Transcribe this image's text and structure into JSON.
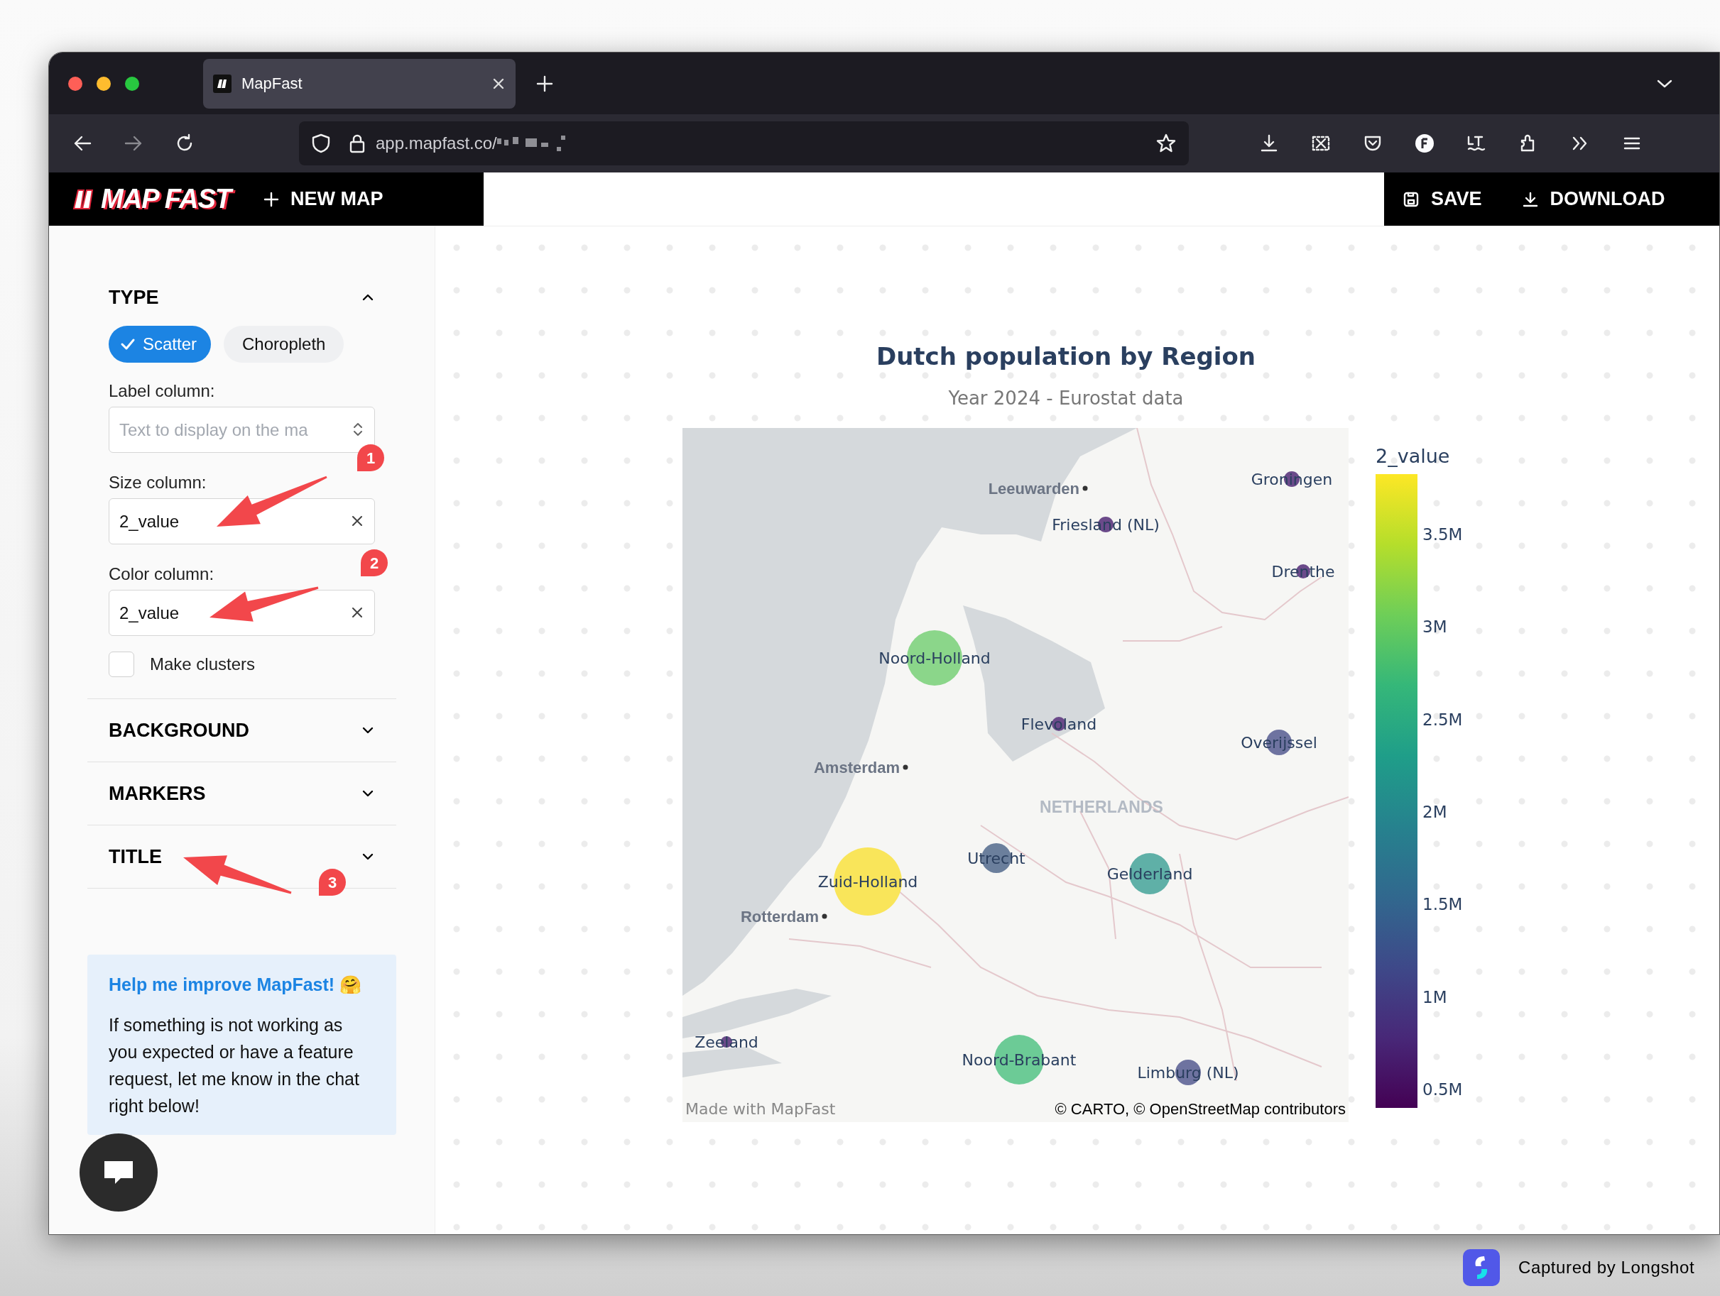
{
  "browser": {
    "tab_title": "MapFast",
    "url": "app.mapfast.co/"
  },
  "app_header": {
    "logo": "MAP FAST",
    "new_map": "NEW MAP",
    "actions": [
      {
        "kind": "save",
        "label": "SAVE"
      },
      {
        "kind": "download",
        "label": "DOWNLOAD"
      }
    ]
  },
  "sidebar": {
    "sections": [
      {
        "title": "TYPE",
        "expanded": true
      },
      {
        "title": "BACKGROUND",
        "expanded": false
      },
      {
        "title": "MARKERS",
        "expanded": false
      },
      {
        "title": "TITLE",
        "expanded": false
      }
    ],
    "type_options": [
      {
        "label": "Scatter",
        "selected": true
      },
      {
        "label": "Choropleth",
        "selected": false
      }
    ],
    "fields": [
      {
        "kind": "select",
        "label": "Label column:",
        "placeholder": "Text to display on the ma"
      },
      {
        "kind": "clearable",
        "label": "Size column:",
        "value": "2_value"
      },
      {
        "kind": "clearable",
        "label": "Color column:",
        "value": "2_value"
      }
    ],
    "clusters": {
      "label": "Make clusters",
      "checked": false
    },
    "help": {
      "title": "Help me improve MapFast! 🤗",
      "text": "If something is not working as you expected or have a feature request, let me know in the chat right below!"
    }
  },
  "annotations": [
    {
      "number": "1"
    },
    {
      "number": "2"
    },
    {
      "number": "3"
    }
  ],
  "map": {
    "title": "Dutch population by Region",
    "subtitle": "Year 2024 - Eurostat data",
    "regions": [
      {
        "name": "Groningen",
        "color": "#6b4a8a"
      },
      {
        "name": "Friesland (NL)",
        "color": "#6b4a8a"
      },
      {
        "name": "Drenthe",
        "color": "#6b4a8a"
      },
      {
        "name": "Noord-Holland",
        "color": "#8bd68a"
      },
      {
        "name": "Flevoland",
        "color": "#6b4a8a"
      },
      {
        "name": "Overijssel",
        "color": "#6e73a0"
      },
      {
        "name": "Utrecht",
        "color": "#6b7f9c"
      },
      {
        "name": "Gelderland",
        "color": "#5fb0a7"
      },
      {
        "name": "Zuid-Holland",
        "color": "#f9e55a"
      },
      {
        "name": "Zeeland",
        "color": "#6b4a8a"
      },
      {
        "name": "Noord-Brabant",
        "color": "#6ccb96"
      },
      {
        "name": "Limburg (NL)",
        "color": "#6e73a0"
      }
    ],
    "cities": [
      "Leeuwarden",
      "Amsterdam",
      "Rotterdam"
    ],
    "country": "NETHERLANDS",
    "made_with": "Made with MapFast",
    "credits": "© CARTO, © OpenStreetMap contributors",
    "colorbar": {
      "title": "2_value",
      "ticks": [
        "3.5M",
        "3M",
        "2.5M",
        "2M",
        "1.5M",
        "1M",
        "0.5M"
      ]
    }
  },
  "capture_credit": "Captured by Longshot"
}
